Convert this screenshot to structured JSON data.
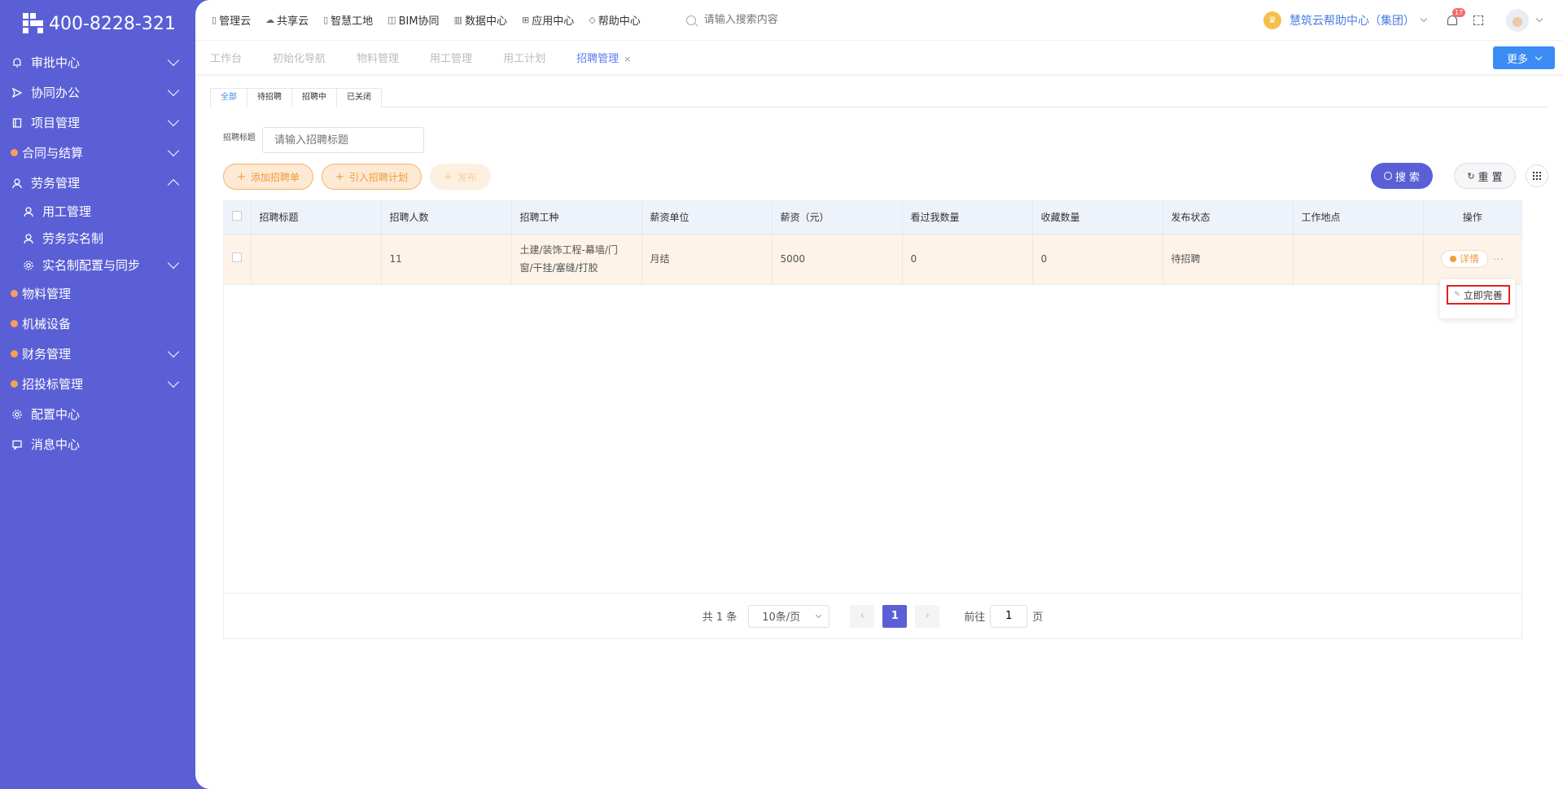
{
  "brand": {
    "phone": "400-8228-321"
  },
  "sidebar": {
    "items": [
      {
        "label": "审批中心",
        "icon": "bell-icon",
        "expandable": true,
        "expanded": false
      },
      {
        "label": "协同办公",
        "icon": "send-icon",
        "expandable": true,
        "expanded": false
      },
      {
        "label": "项目管理",
        "icon": "book-icon",
        "expandable": true,
        "expanded": false
      },
      {
        "label": "合同与结算",
        "icon": "gem-icon",
        "expandable": true,
        "expanded": false
      },
      {
        "label": "劳务管理",
        "icon": "user-icon",
        "expandable": true,
        "expanded": true
      },
      {
        "label": "用工管理",
        "icon": "user-icon",
        "sub": true
      },
      {
        "label": "劳务实名制",
        "icon": "user-icon",
        "sub": true
      },
      {
        "label": "实名制配置与同步",
        "icon": "gear-icon",
        "sub": true,
        "expandable": true
      },
      {
        "label": "物料管理",
        "icon": "gem-icon"
      },
      {
        "label": "机械设备",
        "icon": "gem-icon"
      },
      {
        "label": "财务管理",
        "icon": "gem-icon",
        "expandable": true
      },
      {
        "label": "招投标管理",
        "icon": "gem-icon",
        "expandable": true
      },
      {
        "label": "配置中心",
        "icon": "gear-icon"
      },
      {
        "label": "消息中心",
        "icon": "chat-icon"
      }
    ]
  },
  "topnav": {
    "items": [
      {
        "label": "管理云",
        "icon": "doc-icon"
      },
      {
        "label": "共享云",
        "icon": "cloud-icon"
      },
      {
        "label": "智慧工地",
        "icon": "doc-icon"
      },
      {
        "label": "BIM协同",
        "icon": "cube-icon"
      },
      {
        "label": "数据中心",
        "icon": "bar-chart-icon"
      },
      {
        "label": "应用中心",
        "icon": "apps-icon"
      },
      {
        "label": "帮助中心",
        "icon": "help-icon"
      }
    ],
    "search_placeholder": "请输入搜索内容",
    "org_name": "慧筑云帮助中心（集团）",
    "notification_count": "17"
  },
  "tabs": {
    "items": [
      "工作台",
      "初始化导航",
      "物料管理",
      "用工管理",
      "用工计划",
      "招聘管理"
    ],
    "active": "招聘管理",
    "close": "×",
    "more_label": "更多"
  },
  "subtabs": {
    "items": [
      "全部",
      "待招聘",
      "招聘中",
      "已关闭"
    ],
    "active": "全部"
  },
  "filter": {
    "label": "招聘标题",
    "placeholder": "请输入招聘标题"
  },
  "actions": {
    "add": "添加招聘单",
    "import": "引入招聘计划",
    "publish": "发布",
    "search": "搜 索",
    "reset": "重 置"
  },
  "table": {
    "columns": [
      "招聘标题",
      "招聘人数",
      "招聘工种",
      "薪资单位",
      "薪资（元）",
      "看过我数量",
      "收藏数量",
      "发布状态",
      "工作地点",
      "操作"
    ],
    "rows": [
      {
        "title": "",
        "count": "11",
        "trade": "土建/装饰工程-幕墙/门窗/干挂/塞缝/打胶",
        "salary_unit": "月结",
        "salary": "5000",
        "viewed": "0",
        "favorites": "0",
        "status": "待招聘",
        "location": "",
        "detail_label": "详情",
        "more": "···"
      }
    ],
    "dropdown_item": "立即完善"
  },
  "pagination": {
    "total": "共 1 条",
    "page_size": "10条/页",
    "current": "1",
    "goto_prefix": "前往",
    "goto_value": "1",
    "goto_suffix": "页"
  },
  "colors": {
    "sidebar": "#5b5fd6",
    "accent_blue": "#3b8cf5",
    "orange": "#f09c3c",
    "highlight_red": "#e02020"
  }
}
